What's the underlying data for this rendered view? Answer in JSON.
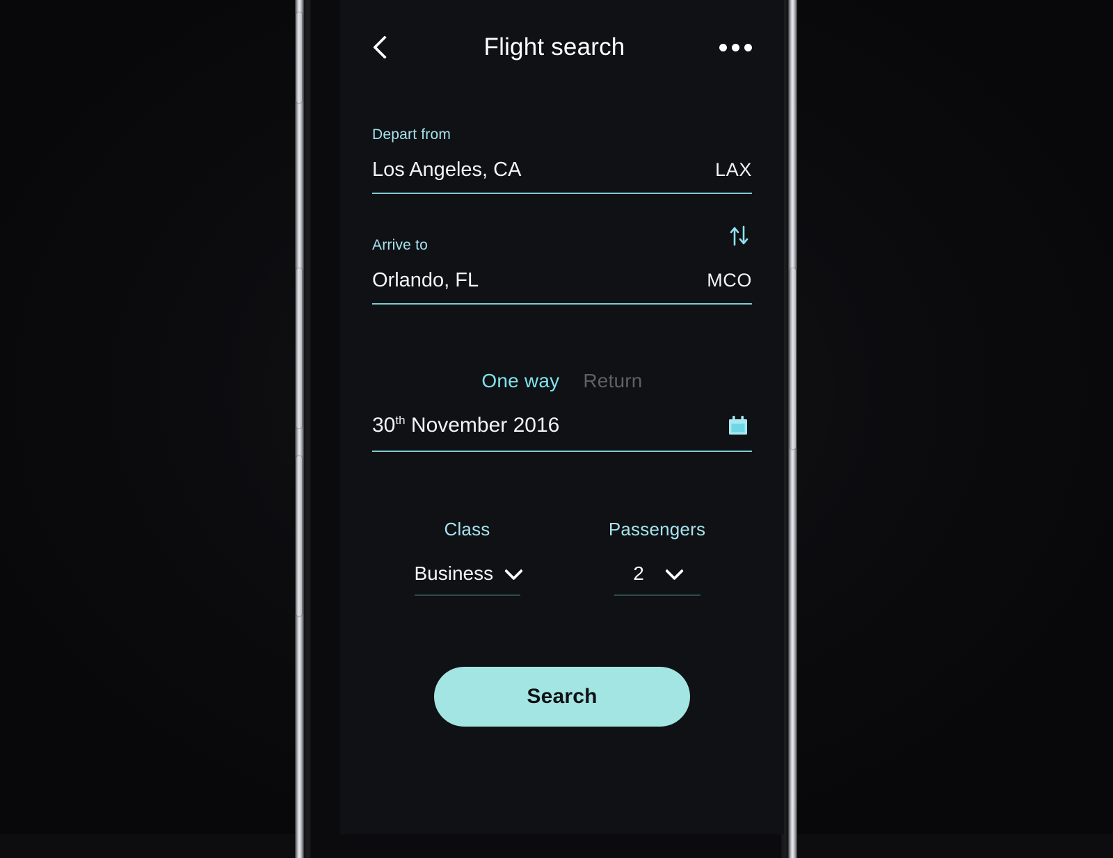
{
  "header": {
    "back_icon": "chevron-left-icon",
    "title": "Flight search",
    "menu_icon": "overflow-menu-icon"
  },
  "form": {
    "depart": {
      "label": "Depart from",
      "city": "Los Angeles, CA",
      "code": "LAX"
    },
    "arrive": {
      "label": "Arrive to",
      "city": "Orlando, FL",
      "code": "MCO"
    },
    "swap_icon": "swap-vertical-icon",
    "trip_types": [
      {
        "label": "One way",
        "active": true
      },
      {
        "label": "Return",
        "active": false
      }
    ],
    "date": {
      "day": "30",
      "ordinal": "th",
      "rest": " November 2016",
      "full": "30th November 2016",
      "calendar_icon": "calendar-icon"
    },
    "class": {
      "label": "Class",
      "value": "Business",
      "chevron_icon": "chevron-down-icon"
    },
    "passengers": {
      "label": "Passengers",
      "value": "2",
      "chevron_icon": "chevron-down-icon"
    },
    "search_button": "Search"
  },
  "colors": {
    "accent_cyan": "#7fe3ef",
    "label_cyan": "#a5e3ef",
    "underline": "#7fcdd4",
    "button_fill": "#a3e5e3",
    "screen_bg": "#101114",
    "inactive_text": "#5c6167"
  },
  "device": {
    "hardware_buttons": [
      "mute-switch",
      "volume-up-button",
      "volume-down-button",
      "power-button"
    ]
  }
}
